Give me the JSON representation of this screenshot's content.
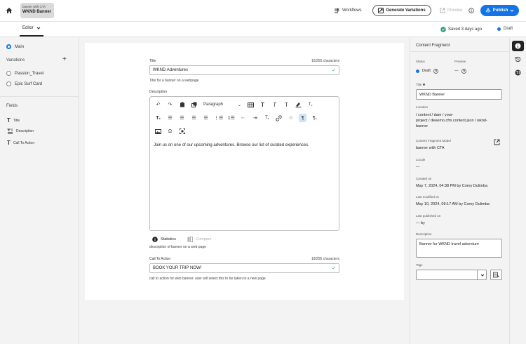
{
  "header": {
    "fragment_model": "banner with CTA",
    "fragment_name": "WKND Banner",
    "workflows_label": "Workflows",
    "generate_label": "Generate Variations",
    "preview_label": "Preview",
    "publish_label": "Publish"
  },
  "subbar": {
    "editor_label": "Editor",
    "saved_text": "Saved 3 days ago",
    "status_label": "Draft"
  },
  "left_panel": {
    "main_label": "Main",
    "variations_title": "Variations",
    "variations": [
      "Passion_Travel",
      "Epic Surf Card"
    ],
    "fields_title": "Fields",
    "fields": [
      "Title",
      "Description",
      "Call To Action"
    ]
  },
  "form": {
    "title": {
      "label": "Title",
      "count": "15/255 characters",
      "value": "WKND Adventures",
      "help": "Title for a banner on a webpage"
    },
    "description": {
      "label": "Description",
      "paragraph_style": "Paragraph",
      "text": "Join us on one of our upcoming adventures. Browse our list of curated experiences.",
      "statistics_label": "Statistics",
      "compare_label": "Compare",
      "help": "description of banner on a web page"
    },
    "cta": {
      "label": "Call To Action",
      "count": "19/255 characters",
      "value": "BOOK YOUR TRIP NOW!",
      "help": "call to action for web banner. user will select this to be taken to a new page"
    }
  },
  "right_panel": {
    "title": "Content Fragment",
    "status_label": "Status",
    "status_value": "Draft",
    "preview_label": "Preview",
    "preview_value": "—",
    "title_label": "Title",
    "title_value": "WKND Banner",
    "location_label": "Location",
    "location_lines": [
      "/ content / dam / your-",
      "project / deeemo.cfm.content.json / wknd-",
      "banner"
    ],
    "model_label": "Content Fragment Model",
    "model_value": "banner with CTA",
    "locale_label": "Locale",
    "locale_value": "—",
    "created_label": "Created on",
    "created_value": "May 7, 2024, 04:38 PM by Corey Dulimba",
    "modified_label": "Last modified on",
    "modified_value": "May 10, 2024, 09:17 AM by Corey Dulimba",
    "published_label": "Last published on",
    "published_value": "— by",
    "description_label": "Description",
    "description_value": "Banner for WKND travel adventure",
    "tags_label": "Tags"
  },
  "colors": {
    "accent": "#1473e6",
    "success": "#2d9d78",
    "selected_tool": "#cfe3f9"
  }
}
